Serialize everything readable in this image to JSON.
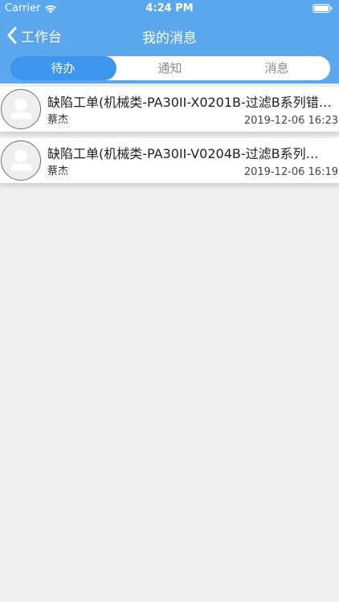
{
  "status_bar": {
    "carrier": "Carrier",
    "time": "4:24 PM"
  },
  "nav": {
    "back_label": "工作台",
    "title": "我的消息"
  },
  "tabs": [
    {
      "label": "待办",
      "active": true
    },
    {
      "label": "通知",
      "active": false
    },
    {
      "label": "消息",
      "active": false
    }
  ],
  "messages": [
    {
      "title": "缺陷工单(机械类-PA30II-X0201B-过滤B系列错…",
      "sender": "蔡杰",
      "time": "2019-12-06 16:23"
    },
    {
      "title": "缺陷工单(机械类-PA30II-V0204B-过滤B系列…",
      "sender": "蔡杰",
      "time": "2019-12-06 16:19"
    }
  ],
  "colors": {
    "header": "#5aa7ee",
    "active_tab": "#3d95ee",
    "background": "#efefef"
  },
  "icons": {
    "back": "chevron-left-icon",
    "wifi": "wifi-icon",
    "battery": "battery-icon",
    "avatar": "user-avatar-icon"
  }
}
